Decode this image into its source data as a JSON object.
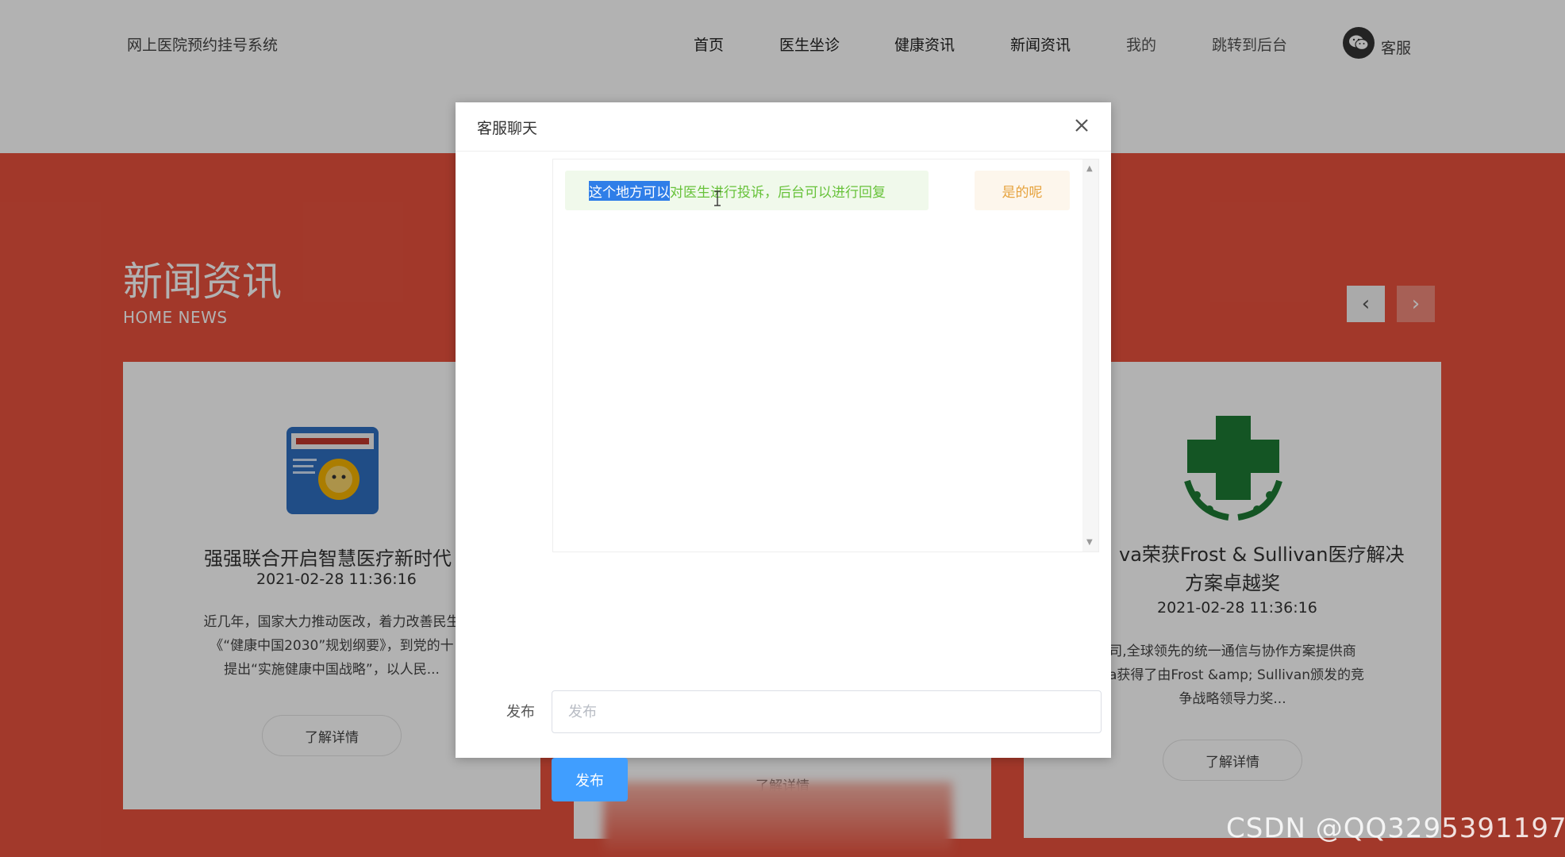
{
  "header": {
    "site_title": "网上医院预约挂号系统",
    "nav": [
      "首页",
      "医生坐诊",
      "健康资讯",
      "新闻资讯",
      "我的",
      "跳转到后台"
    ],
    "customer_service_label": "客服"
  },
  "section": {
    "title": "新闻资讯",
    "subtitle": "HOME NEWS",
    "prev_icon": "‹",
    "next_icon": "›"
  },
  "cards": [
    {
      "title": "强强联合开启智慧医疗新时代",
      "date": "2021-02-28 11:36:16",
      "excerpt": [
        "近几年，国家大力推动医改，着力改善民生",
        "《“健康中国2030”规划纲要》，到党的十",
        "提出“实施健康中国战略”，以人民..."
      ],
      "button": "了解详情"
    },
    {
      "button": "了解详情"
    },
    {
      "title_lines": [
        "va荣获Frost & Sullivan医疗解决",
        "方案卓越奖"
      ],
      "date": "2021-02-28 11:36:16",
      "excerpt": [
        "司,全球领先的统一通信与协作方案提供商",
        "ya获得了由Frost &amp; Sullivan颁发的竞",
        "争战略领导力奖..."
      ],
      "button": "了解详情"
    }
  ],
  "dialog": {
    "title": "客服聊天",
    "messages": {
      "user_selected": "这个地方可以",
      "user_rest": "对医生进行投诉，后台可以进行回复",
      "reply": "是的呢"
    },
    "form_label": "发布",
    "input_placeholder": "发布",
    "input_value": "",
    "submit_label": "发布"
  },
  "watermark": "CSDN @QQ3295391197",
  "colors": {
    "band": "#e8513d",
    "primary_button": "#409eff",
    "user_message_bg": "#f0f9eb",
    "user_message_text": "#67c23a",
    "reply_bg": "#fdf6ec",
    "reply_text": "#e6a23c"
  }
}
